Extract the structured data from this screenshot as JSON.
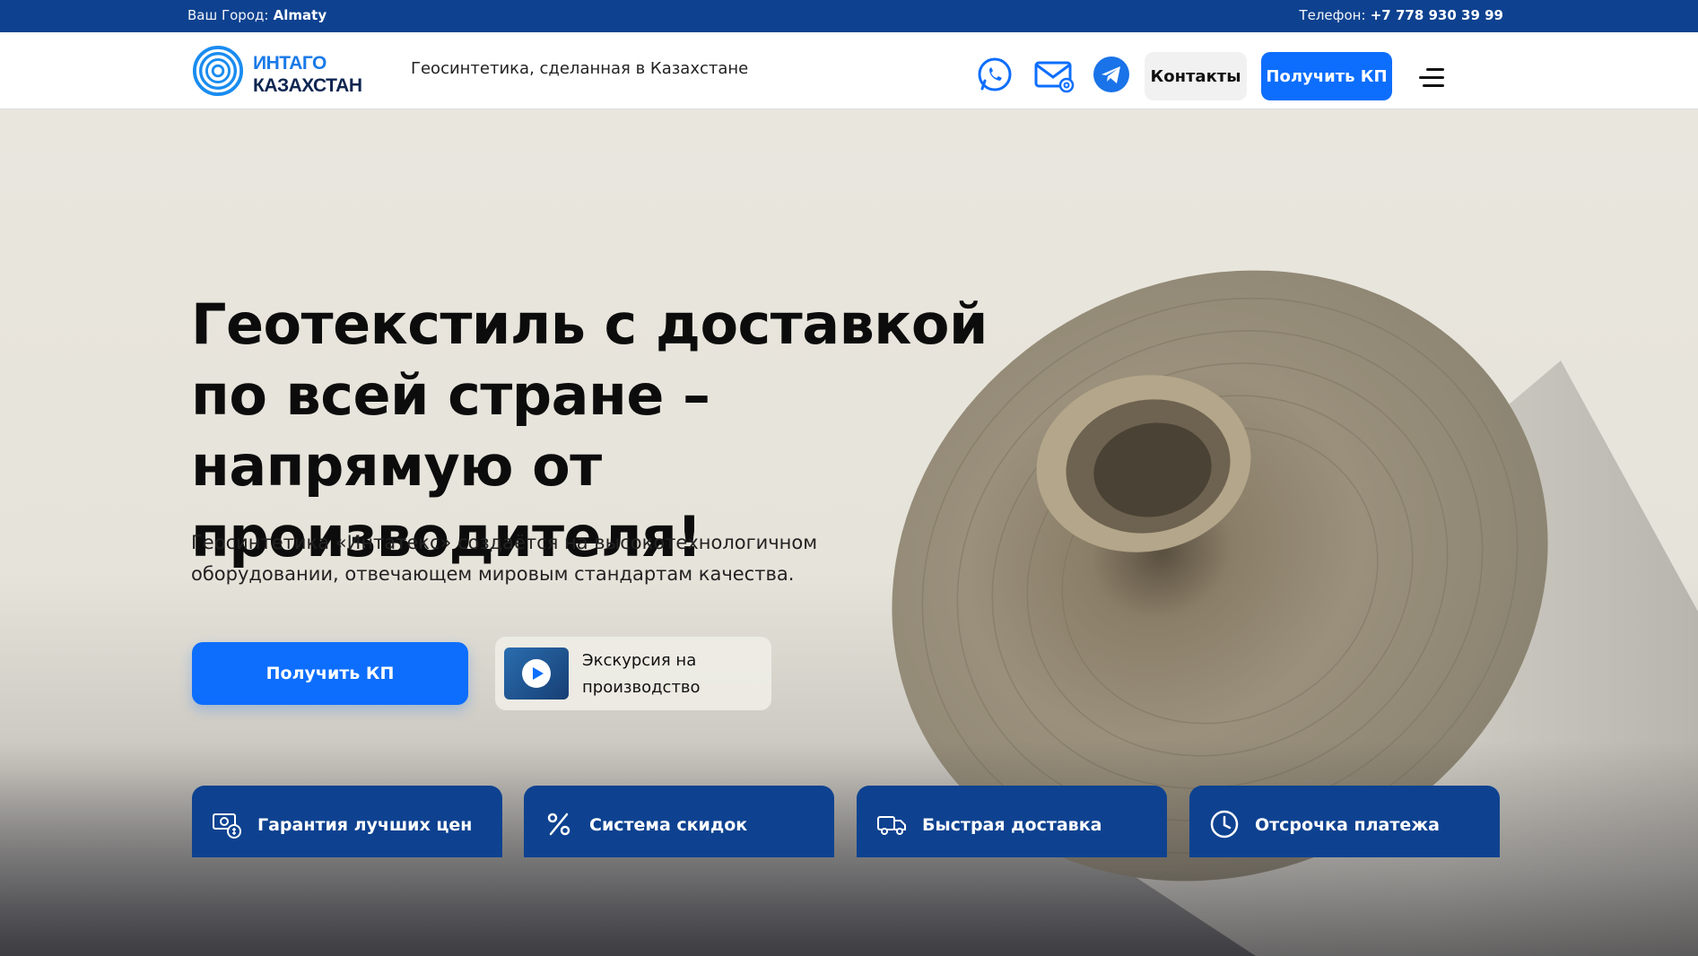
{
  "topbar": {
    "city_label": "Ваш Город:",
    "city_value": "Almaty",
    "phone_label": "Телефон:",
    "phone_value": "+7 778 930 39 99"
  },
  "header": {
    "logo_line1": "ИНТАГО",
    "logo_line2": "КАЗАХСТАН",
    "tagline": "Геосинтетика, сделанная в Казахстане",
    "contacts_label": "Контакты",
    "kp_label": "Получить КП",
    "icons": [
      "whatsapp-icon",
      "mail-icon",
      "telegram-icon",
      "menu-icon"
    ]
  },
  "hero": {
    "title": "Геотекстиль с доставкой по всей стране – напрямую от производителя!",
    "subtitle": "Геосинтетика «Интатекс» создаётся на высокотехнологичном оборудовании, отвечающем мировым стандартам качества.",
    "kp_button": "Получить КП",
    "tour_line1": "Экскурсия на",
    "tour_line2": "производство"
  },
  "features": [
    {
      "label": "Гарантия лучших цен",
      "icon": "price-guarantee-icon"
    },
    {
      "label": "Система скидок",
      "icon": "percent-icon"
    },
    {
      "label": "Быстрая доставка",
      "icon": "truck-icon"
    },
    {
      "label": "Отсрочка платежа",
      "icon": "clock-icon"
    }
  ],
  "colors": {
    "topbar_bg": "#0e4290",
    "accent": "#0d6efd",
    "card_bg": "#0e4290"
  }
}
